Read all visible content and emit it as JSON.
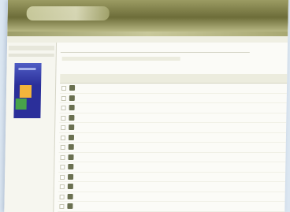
{
  "window": {
    "title": ""
  },
  "sidebar": {
    "heading": ""
  },
  "main": {
    "heading": "",
    "meta": ""
  },
  "table": {
    "columns": [
      "",
      "",
      "",
      "",
      ""
    ],
    "rows": [
      {
        "name": "",
        "date": "",
        "author": ""
      },
      {
        "name": "",
        "date": "",
        "author": ""
      },
      {
        "name": "",
        "date": "",
        "author": ""
      },
      {
        "name": "",
        "date": "",
        "author": ""
      },
      {
        "name": "",
        "date": "",
        "author": ""
      },
      {
        "name": "",
        "date": "",
        "author": ""
      },
      {
        "name": "",
        "date": "",
        "author": ""
      },
      {
        "name": "",
        "date": "",
        "author": ""
      },
      {
        "name": "",
        "date": "",
        "author": ""
      },
      {
        "name": "",
        "date": "",
        "author": ""
      },
      {
        "name": "",
        "date": "",
        "author": ""
      },
      {
        "name": "",
        "date": "",
        "author": ""
      },
      {
        "name": "",
        "date": "",
        "author": ""
      }
    ]
  },
  "colors": {
    "titlebar": "#6d6d39",
    "link": "#5f77c8",
    "book_cover": "#2b2f9a",
    "book_yellow": "#f3b53b",
    "book_green": "#48a34a"
  },
  "icons": {
    "row_icon": "document-icon",
    "logo": "app-logo-icon"
  }
}
